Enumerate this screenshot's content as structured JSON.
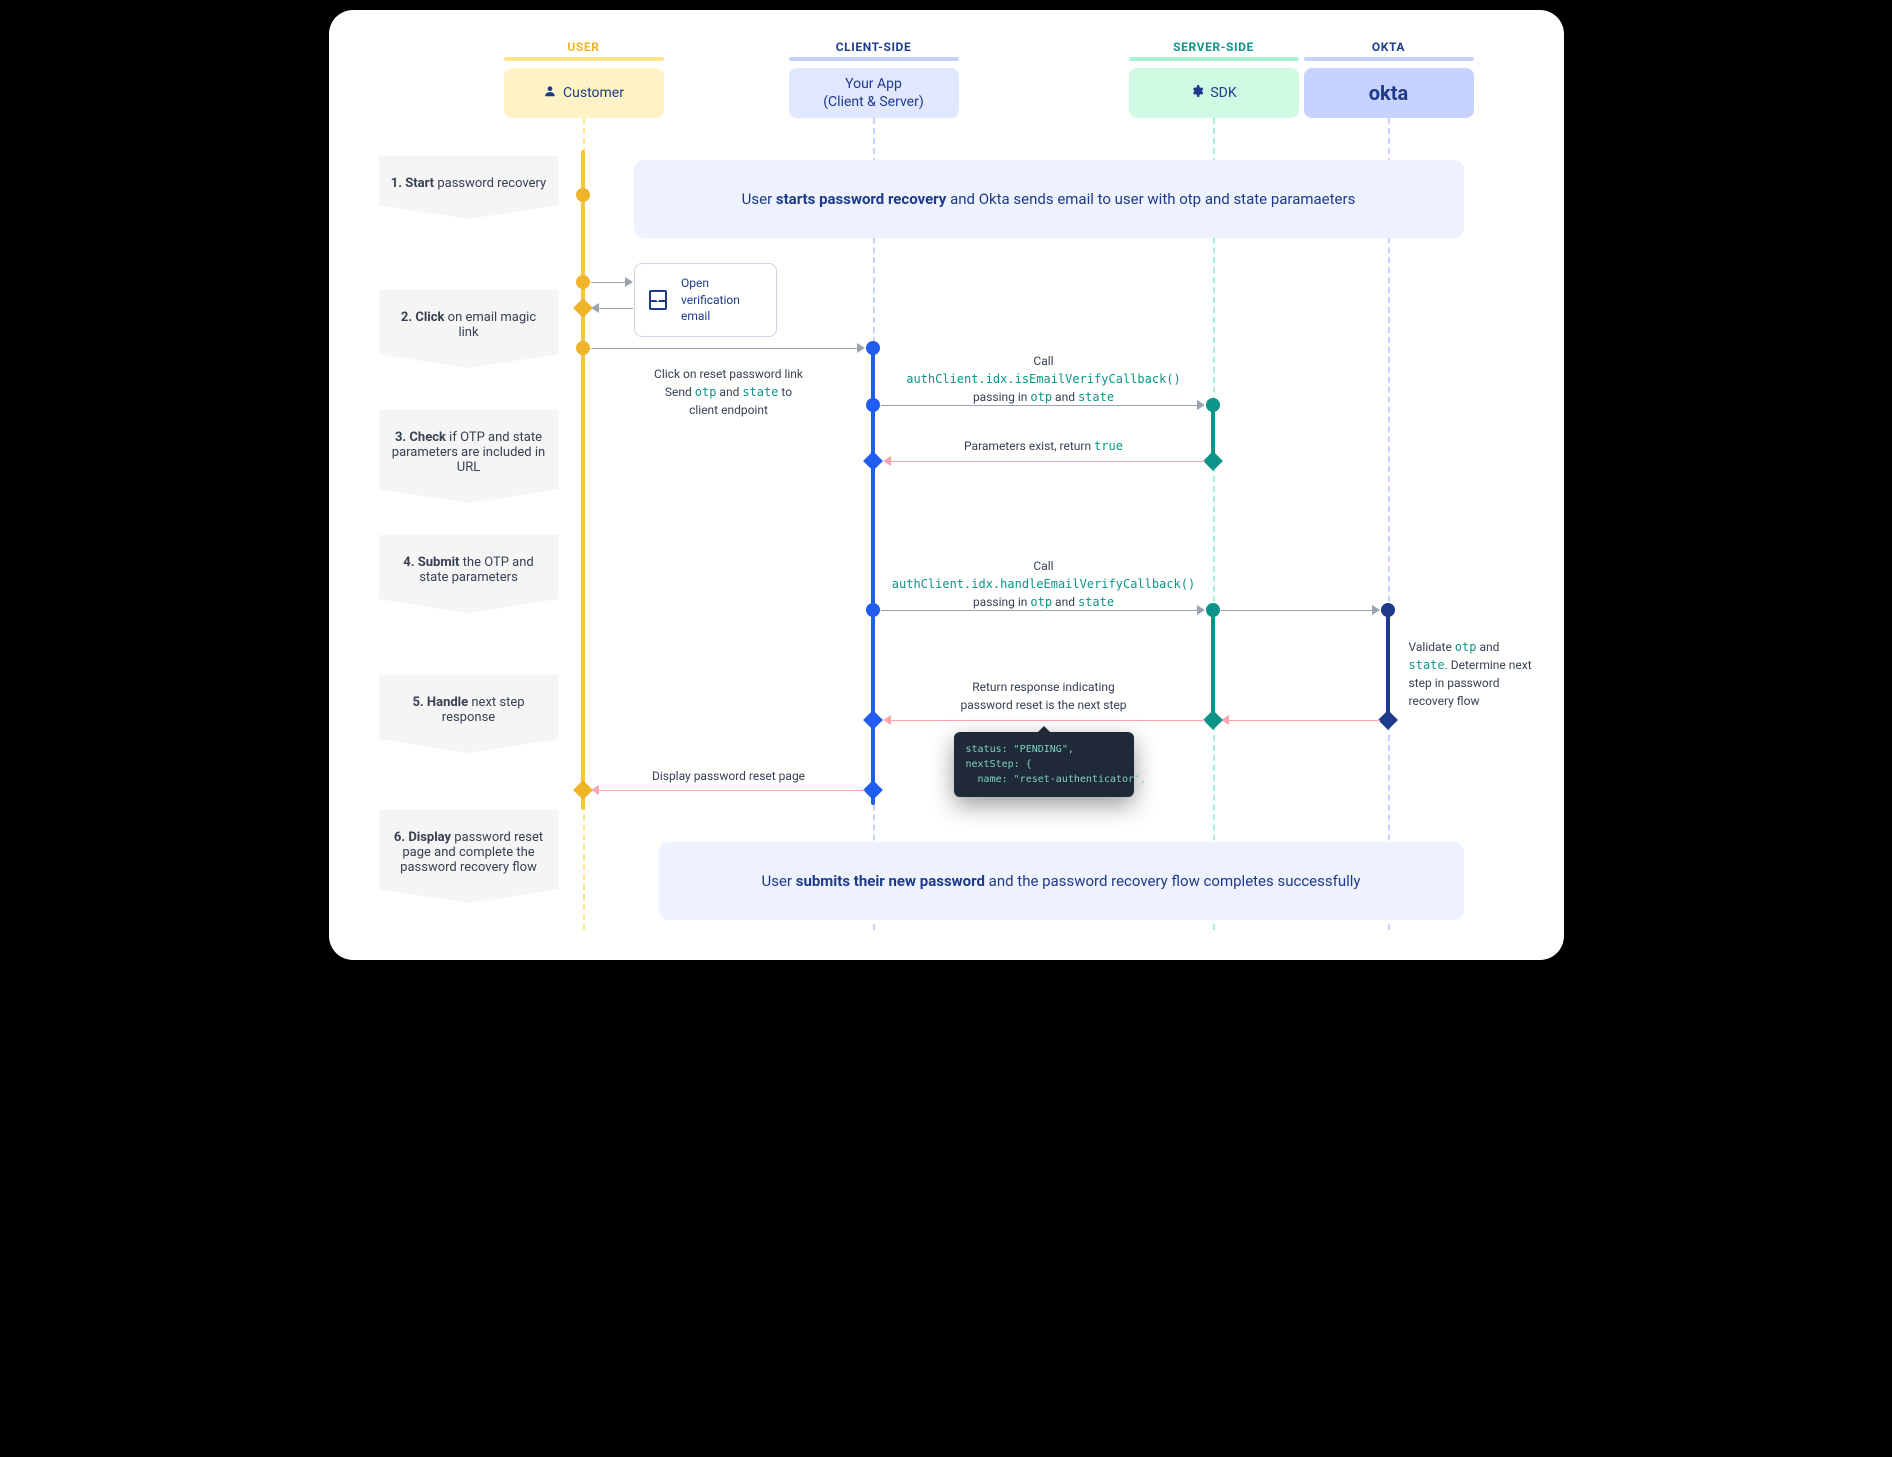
{
  "columns": {
    "user": {
      "header": "USER",
      "box": "Customer"
    },
    "client": {
      "header": "CLIENT-SIDE",
      "box_line1": "Your App",
      "box_line2": "(Client & Server)"
    },
    "server": {
      "header": "SERVER-SIDE",
      "box": "SDK"
    },
    "okta": {
      "header": "OKTA",
      "box": "okta"
    }
  },
  "steps": {
    "s1_pre": "1. Start",
    "s1_post": " password recovery",
    "s2_pre": "2. Click",
    "s2_post": " on email magic link",
    "s3_pre": "3. Check",
    "s3_post": " if OTP and state parameters are included in URL",
    "s4_pre": "4. Submit",
    "s4_post": " the OTP and state parameters",
    "s5_pre": "5. Handle",
    "s5_post": " next step response",
    "s6_pre": "6. Display",
    "s6_post": " password reset page and complete the password recovery flow"
  },
  "banner1_pre": "User ",
  "banner1_b": "starts password recovery",
  "banner1_post": " and Okta sends email to user with otp and state paramaeters",
  "banner2_pre": "User ",
  "banner2_b": "submits their new password",
  "banner2_post": " and the password recovery flow completes successfully",
  "email_label": "Open verification email",
  "msg1_line1": "Click on reset password link",
  "msg1_line2_pre": "Send ",
  "msg1_otp": "otp",
  "msg1_and": " and ",
  "msg1_state": "state",
  "msg1_to": " to",
  "msg1_line3": "client endpoint",
  "msg2_line1": "Call",
  "msg2_line2": "authClient.idx.isEmailVerifyCallback()",
  "msg2_line3_pre": "passing in ",
  "msg2_otp": "otp",
  "msg2_and": " and ",
  "msg2_state": "state",
  "msg3_pre": "Parameters exist, return ",
  "msg3_true": "true",
  "msg4_line1": "Call",
  "msg4_line2": "authClient.idx.handleEmailVerifyCallback()",
  "msg4_line3_pre": "passing in ",
  "msg4_otp": "otp",
  "msg4_and": " and ",
  "msg4_state": "state",
  "msg5_line1": "Return response indicating",
  "msg5_line2": "password reset is the next step",
  "msg6": "Display password reset page",
  "validate_pre": "Validate ",
  "validate_otp": "otp",
  "validate_and": " and ",
  "validate_state": "state",
  "validate_post": ". Determine next step in password recovery flow",
  "tooltip": "status: \"PENDING\",\nnextStep: {\n  name: \"reset-authenticator\","
}
